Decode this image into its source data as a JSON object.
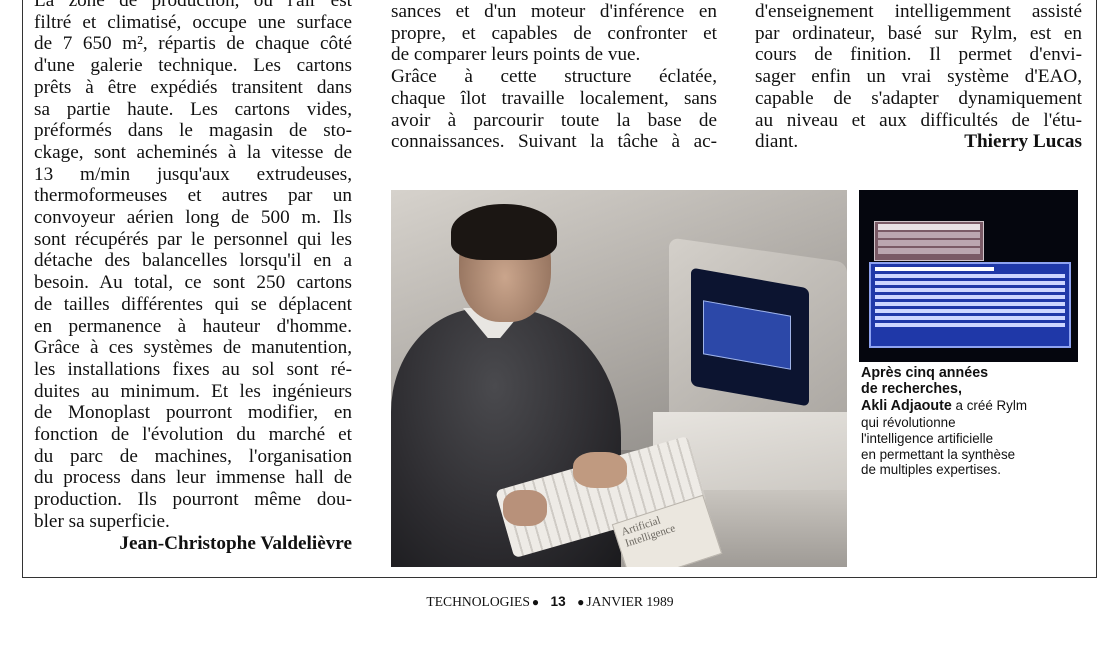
{
  "col1": {
    "lines": [
      "La zone de production, où l'air est",
      "filtré et climatisé, occupe une surface",
      "de 7 650 m², répartis de chaque côté",
      "d'une galerie technique. Les cartons",
      "prêts à être expédiés transitent dans",
      "sa partie haute. Les cartons vides,",
      "préformés dans le magasin de sto-",
      "ckage, sont acheminés à la vitesse de",
      "13 m/min jusqu'aux extrudeuses,",
      "thermoformeuses et autres par un",
      "convoyeur aérien long de 500 m. Ils",
      "sont récupérés par le personnel qui les",
      "détache des balancelles lorsqu'il en a",
      "besoin. Au total, ce sont 250 cartons",
      "de tailles différentes qui se déplacent",
      "en permanence à hauteur d'homme.",
      "Grâce à ces systèmes de manutention,",
      "les installations fixes au sol sont ré-",
      "duites au minimum. Et les ingénieurs",
      "de Monoplast pourront modifier, en",
      "fonction de l'évolution du marché et",
      "du parc de machines, l'organisation",
      "du process dans leur immense hall de",
      "production. Ils pourront même dou-",
      "bler sa superficie."
    ],
    "signature": "Jean-Christophe Valdelièvre"
  },
  "col2": {
    "lines": [
      "sances et d'un moteur d'inférence en",
      "propre, et capables de confronter et",
      "de comparer leurs points de vue.",
      "Grâce à cette structure éclatée,",
      "chaque îlot travaille localement, sans",
      "avoir à parcourir toute la base de",
      "connaissances. Suivant la tâche à ac-"
    ]
  },
  "col3": {
    "lines": [
      "d'enseignement intelligemment assisté",
      "par ordinateur, basé sur Rylm, est en",
      "cours de finition. Il permet d'envi-",
      "sager enfin un vrai système d'EAO,",
      "capable de s'adapter dynamiquement",
      "au niveau et aux difficultés de l'étu-"
    ],
    "last_word": "diant.",
    "signature": "Thierry Lucas"
  },
  "photo": {
    "book_text": "Artificial Intelligence"
  },
  "caption": {
    "bold_line1": "Après cinq années",
    "bold_line2": "de recherches,",
    "name": "Akli Adjaoute",
    "rest1": " a créé Rylm",
    "line4": "qui révolutionne",
    "line5": "l'intelligence artificielle",
    "line6": "en permettant la synthèse",
    "line7": "de multiples expertises."
  },
  "footer": {
    "magazine": "TECHNOLOGIES",
    "page_number": "13",
    "date": "JANVIER 1989"
  }
}
